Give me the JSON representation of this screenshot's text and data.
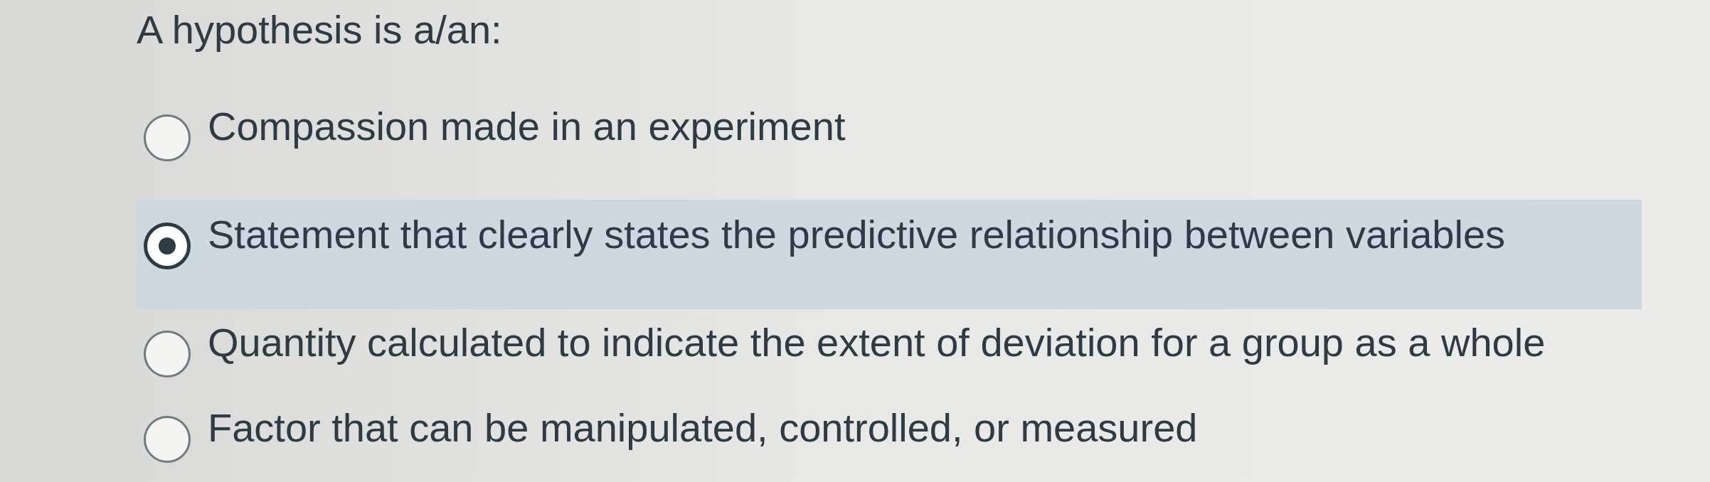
{
  "question": {
    "text": "A hypothesis is a/an:"
  },
  "options": [
    {
      "label": "Compassion made in an experiment",
      "selected": false
    },
    {
      "label": "Statement that clearly states the predictive relationship between variables",
      "selected": true
    },
    {
      "label": "Quantity calculated to indicate the extent of deviation for a group as a whole",
      "selected": false
    },
    {
      "label": "Factor that can be manipulated, controlled, or measured",
      "selected": false
    }
  ]
}
